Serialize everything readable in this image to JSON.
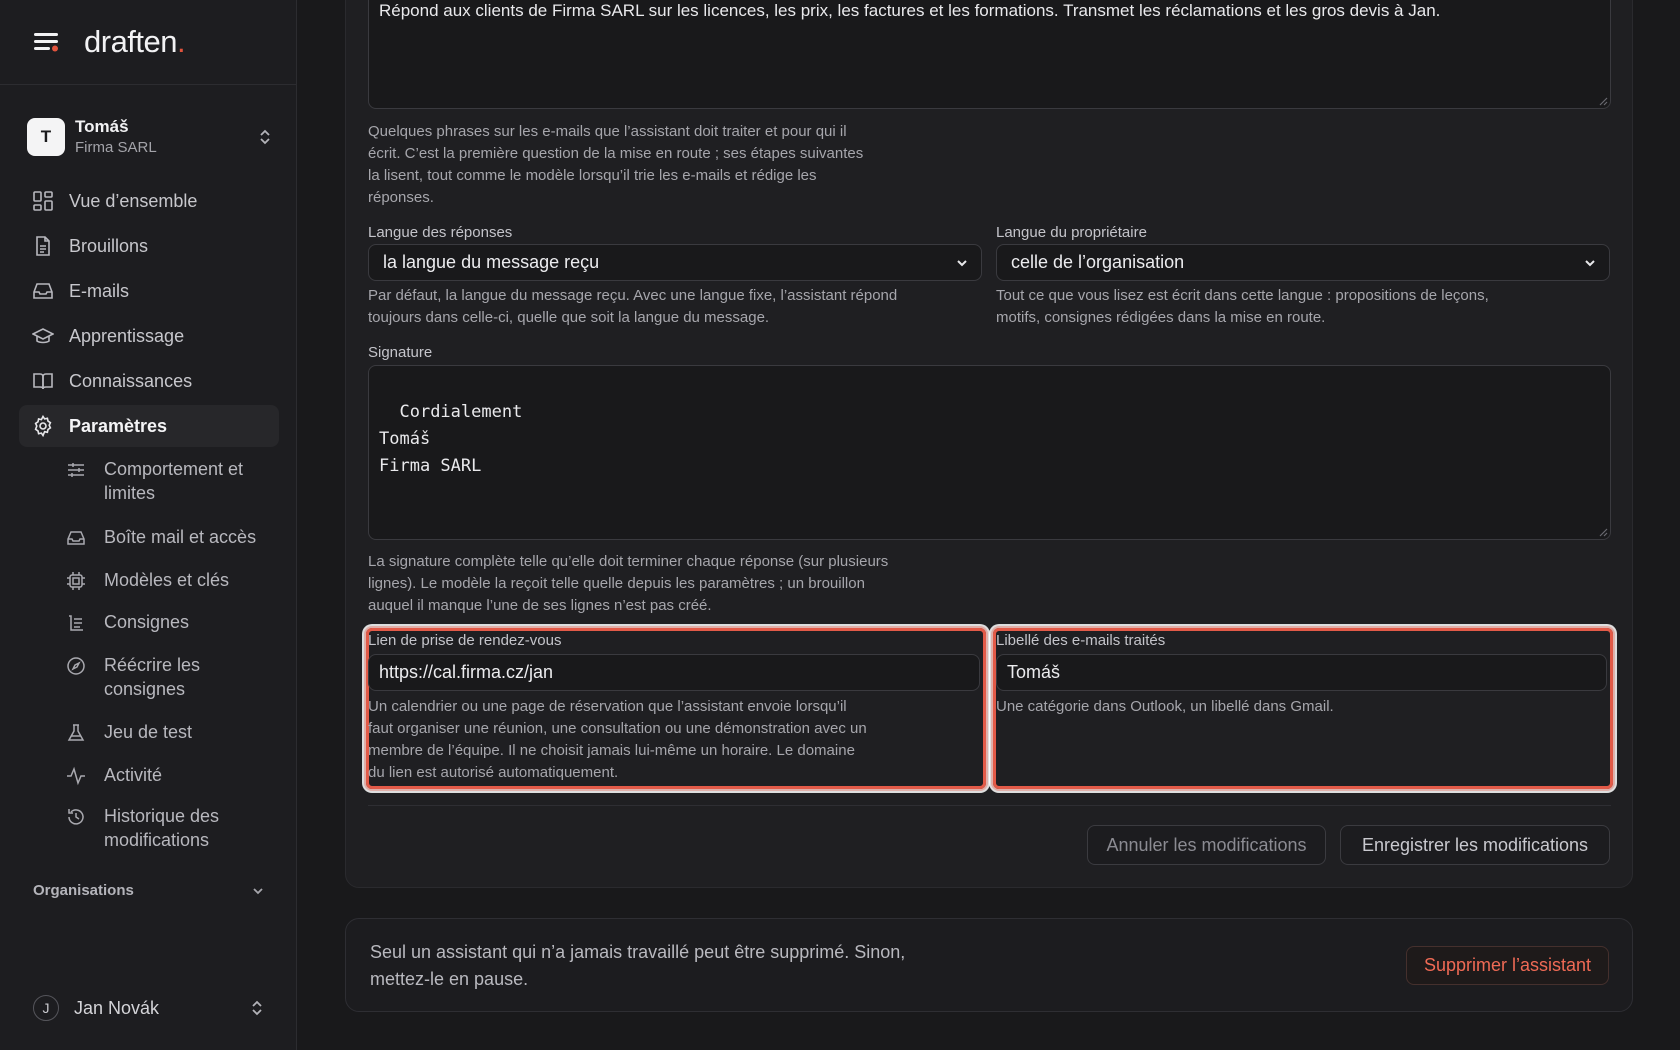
{
  "brand": {
    "name": "draften",
    "dot": "."
  },
  "account": {
    "initial": "T",
    "name": "Tomáš",
    "org": "Firma SARL"
  },
  "nav": [
    {
      "label": "Vue d’ensemble",
      "icon": "grid-icon"
    },
    {
      "label": "Brouillons",
      "icon": "document-icon"
    },
    {
      "label": "E-mails",
      "icon": "inbox-icon"
    },
    {
      "label": "Apprentissage",
      "icon": "graduation-cap-icon"
    },
    {
      "label": "Connaissances",
      "icon": "book-icon"
    },
    {
      "label": "Paramètres",
      "icon": "gear-icon",
      "active": true
    }
  ],
  "subnav": [
    {
      "label": "Comportement et limites",
      "icon": "sliders-icon"
    },
    {
      "label": "Boîte mail et accès",
      "icon": "inbox-icon"
    },
    {
      "label": "Modèles et clés",
      "icon": "chip-icon"
    },
    {
      "label": "Consignes",
      "icon": "list-icon"
    },
    {
      "label": "Réécrire les consignes",
      "icon": "compass-icon"
    },
    {
      "label": "Jeu de test",
      "icon": "flask-icon"
    },
    {
      "label": "Activité",
      "icon": "activity-icon"
    },
    {
      "label": "Historique des modifications",
      "icon": "history-icon"
    }
  ],
  "orgs_label": "Organisations",
  "user": {
    "initial": "J",
    "name": "Jan Novák"
  },
  "form": {
    "description_value": "Répond aux clients de Firma SARL sur les licences, les prix, les factures et les formations. Transmet les réclamations et les gros devis à Jan.",
    "description_help": "Quelques phrases sur les e-mails que l’assistant doit traiter et pour qui il écrit. C’est la première question de la mise en route ; ses étapes suivantes la lisent, tout comme le modèle lorsqu’il trie les e-mails et rédige les réponses.",
    "reply_language": {
      "label": "Langue des réponses",
      "value": "la langue du message reçu",
      "help": "Par défaut, la langue du message reçu. Avec une langue fixe, l’assistant répond toujours dans celle-ci, quelle que soit la langue du message."
    },
    "owner_language": {
      "label": "Langue du propriétaire",
      "value": "celle de l’organisation",
      "help": "Tout ce que vous lisez est écrit dans cette langue : propositions de leçons, motifs, consignes rédigées dans la mise en route."
    },
    "signature": {
      "label": "Signature",
      "value": "Cordialement\nTomáš\nFirma SARL",
      "help": "La signature complète telle qu’elle doit terminer chaque réponse (sur plusieurs lignes). Le modèle la reçoit telle quelle depuis les paramètres ; un brouillon auquel il manque l’une de ses lignes n’est pas créé."
    },
    "booking_link": {
      "label": "Lien de prise de rendez-vous",
      "value": "https://cal.firma.cz/jan",
      "help": "Un calendrier ou une page de réservation que l’assistant envoie lorsqu’il faut organiser une réunion, une consultation ou une démonstration avec un membre de l’équipe. Il ne choisit jamais lui-même un horaire. Le domaine du lien est autorisé automatiquement."
    },
    "processed_label": {
      "label": "Libellé des e-mails traités",
      "value": "Tomáš",
      "help": "Une catégorie dans Outlook, un libellé dans Gmail."
    },
    "cancel_label": "Annuler les modifications",
    "save_label": "Enregistrer les modifications"
  },
  "danger": {
    "text": "Seul un assistant qui n’a jamais travaillé peut être supprimé. Sinon, mettez-le en pause.",
    "delete_label": "Supprimer l’assistant"
  },
  "colors": {
    "accent": "#e25a48",
    "brand_dot": "#e0533d",
    "danger": "#ef6a55"
  }
}
